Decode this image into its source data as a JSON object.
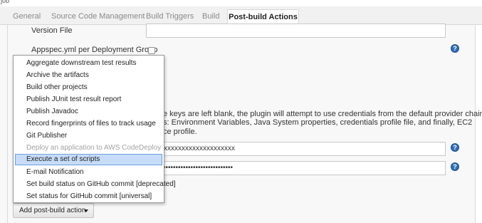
{
  "page": {
    "top_fragment": "job"
  },
  "tabs": [
    {
      "label": "General",
      "active": false
    },
    {
      "label": "Source Code Management",
      "active": false
    },
    {
      "label": "Build Triggers",
      "active": false
    },
    {
      "label": "Build",
      "active": false
    },
    {
      "label": "Post-build Actions",
      "active": true
    }
  ],
  "form": {
    "version_file_label": "Version File",
    "version_file_value": "",
    "appspec_label": "Appspec.yml per Deployment Group",
    "appspec_checked": false,
    "credentials_desc": [
      "e keys are left blank, the plugin will attempt to use credentials from the default provider chain.",
      "s: Environment Variables, Java System properties, credentials profile file, and finally, EC2",
      "ce profile."
    ],
    "access_key_value": "xxxxxxxxxxxxxxxxxxxx",
    "secret_key_value": "••••••••••••••••••••••••••••"
  },
  "help_icon": {
    "glyph": "?"
  },
  "menu": {
    "items": [
      {
        "label": "Aggregate downstream test results",
        "state": "normal"
      },
      {
        "label": "Archive the artifacts",
        "state": "normal"
      },
      {
        "label": "Build other projects",
        "state": "normal"
      },
      {
        "label": "Publish JUnit test result report",
        "state": "normal"
      },
      {
        "label": "Publish Javadoc",
        "state": "normal"
      },
      {
        "label": "Record fingerprints of files to track usage",
        "state": "normal"
      },
      {
        "label": "Git Publisher",
        "state": "normal"
      },
      {
        "label": "Deploy an application to AWS CodeDeploy",
        "state": "disabled"
      },
      {
        "label": "Execute a set of scripts",
        "state": "selected"
      },
      {
        "label": "E-mail Notification",
        "state": "normal"
      },
      {
        "label": "Set build status on GitHub commit [deprecated]",
        "state": "normal"
      },
      {
        "label": "Set status for GitHub commit [universal]",
        "state": "normal"
      }
    ]
  },
  "add_button": {
    "label": "Add post-build action",
    "icon": "caret-down-icon"
  }
}
